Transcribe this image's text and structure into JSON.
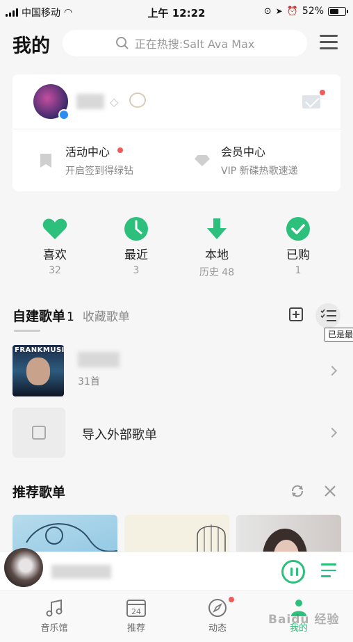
{
  "status_bar": {
    "carrier": "中国移动",
    "time": "上午 12:22",
    "battery": "52%"
  },
  "header": {
    "title": "我的",
    "search_placeholder": "正在热搜:Salt Ava Max"
  },
  "profile": {
    "activity": {
      "title": "活动中心",
      "subtitle": "开启签到得绿钻"
    },
    "vip": {
      "title": "会员中心",
      "subtitle": "VIP 新碟热歌速递"
    }
  },
  "quick": [
    {
      "label": "喜欢",
      "count": "32",
      "icon": "heart-icon"
    },
    {
      "label": "最近",
      "count": "3",
      "icon": "clock-icon"
    },
    {
      "label": "本地",
      "count": "历史 48",
      "icon": "download-icon"
    },
    {
      "label": "已购",
      "count": "1",
      "icon": "check-icon"
    }
  ],
  "playlists": {
    "tab_created": "自建歌单",
    "tab_created_count": "1",
    "tab_favorite": "收藏歌单",
    "tooltip": "已是最",
    "cover_text": "FRANKMUSIK",
    "item_count": "31首",
    "import_label": "导入外部歌单"
  },
  "recommend": {
    "title": "推荐歌单"
  },
  "tabbar": [
    {
      "label": "音乐馆",
      "icon": "music-note-icon"
    },
    {
      "label": "推荐",
      "icon": "calendar-icon",
      "icon_text": "24"
    },
    {
      "label": "动态",
      "icon": "compass-icon"
    },
    {
      "label": "我的",
      "icon": "person-icon"
    }
  ],
  "watermark": "Baidu 经验",
  "colors": {
    "accent": "#2cc07c",
    "badge": "#f05a5a"
  }
}
